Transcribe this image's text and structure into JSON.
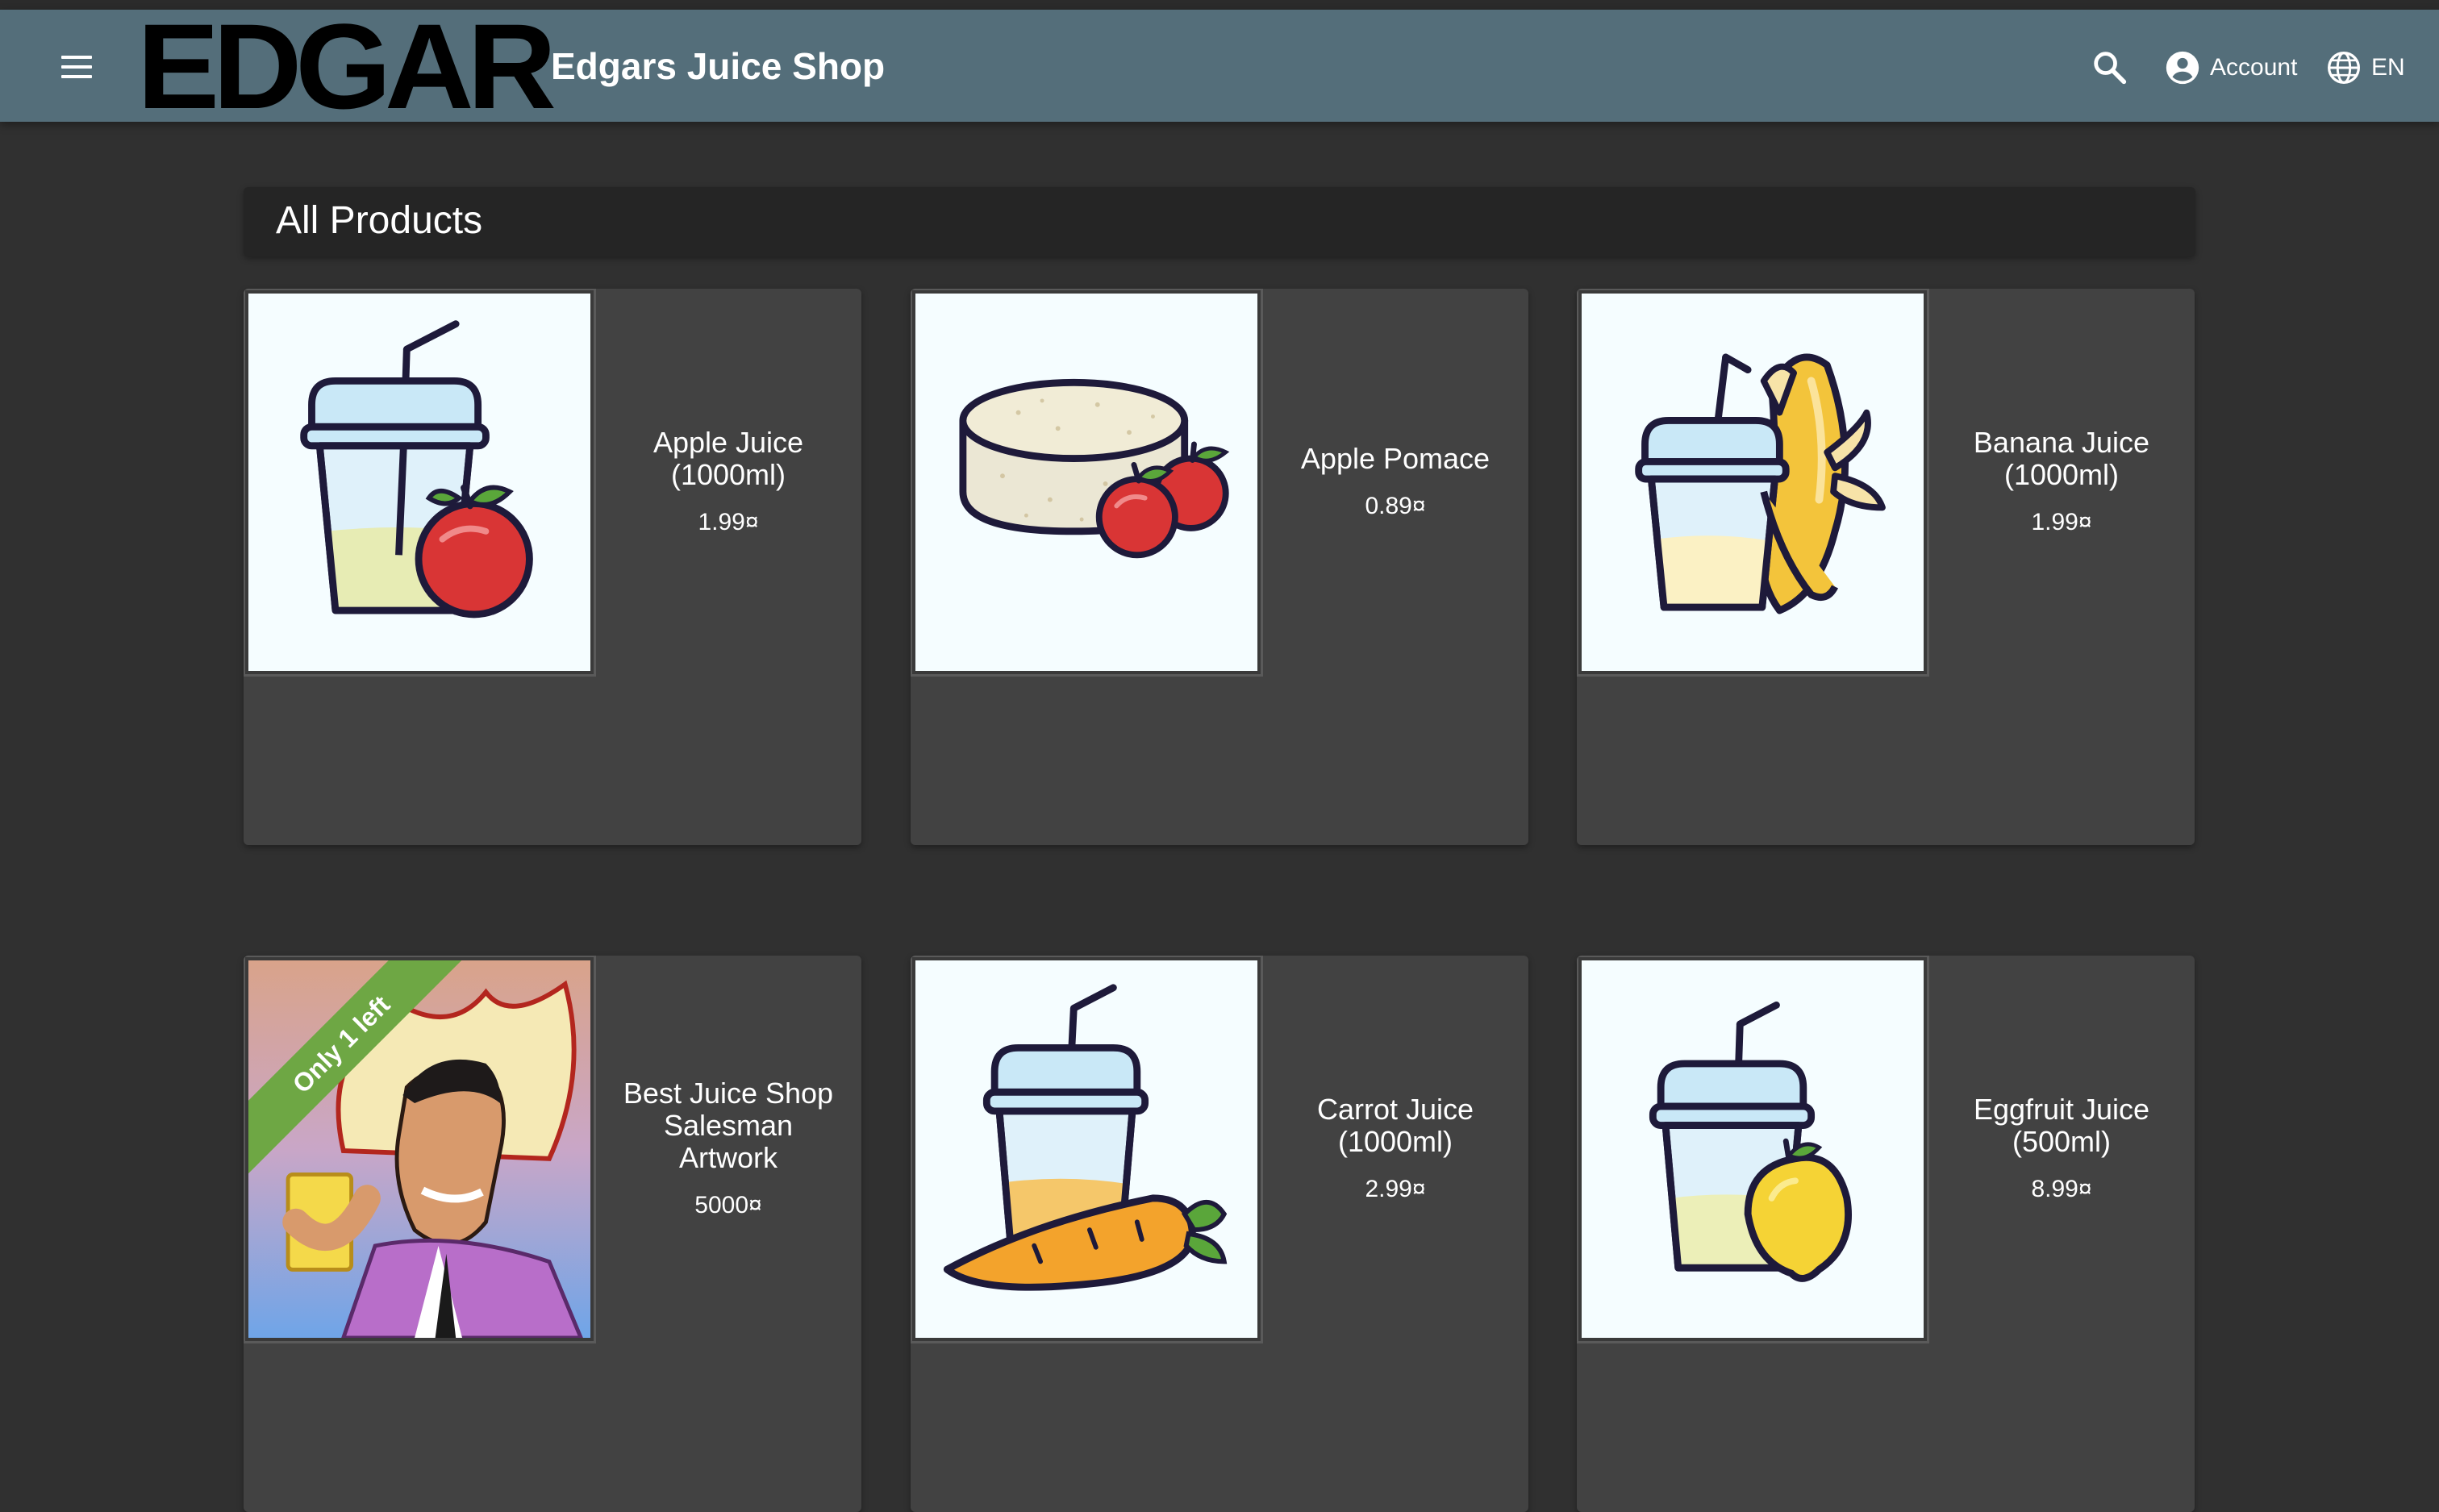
{
  "header": {
    "logo_text": "EDGAR",
    "shop_name": "Edgars Juice Shop",
    "account_label": "Account",
    "language_label": "EN",
    "icons": [
      "menu-icon",
      "search-icon",
      "account-circle-icon",
      "language-globe-icon"
    ]
  },
  "main": {
    "title": "All Products",
    "products": [
      {
        "name": "Apple Juice (1000ml)",
        "price": "1.99¤",
        "image": "apple-juice-illustration"
      },
      {
        "name": "Apple Pomace",
        "price": "0.89¤",
        "image": "apple-pomace-illustration"
      },
      {
        "name": "Banana Juice (1000ml)",
        "price": "1.99¤",
        "image": "banana-juice-illustration"
      },
      {
        "name": "Best Juice Shop Salesman Artwork",
        "price": "5000¤",
        "image": "salesman-artwork",
        "badge": "Only 1 left"
      },
      {
        "name": "Carrot Juice (1000ml)",
        "price": "2.99¤",
        "image": "carrot-juice-illustration"
      },
      {
        "name": "Eggfruit Juice (500ml)",
        "price": "8.99¤",
        "image": "eggfruit-juice-illustration"
      }
    ]
  },
  "colors": {
    "toolbar": "#546e7a",
    "background": "#303030",
    "card": "#424242",
    "badge": "#6ea744"
  }
}
